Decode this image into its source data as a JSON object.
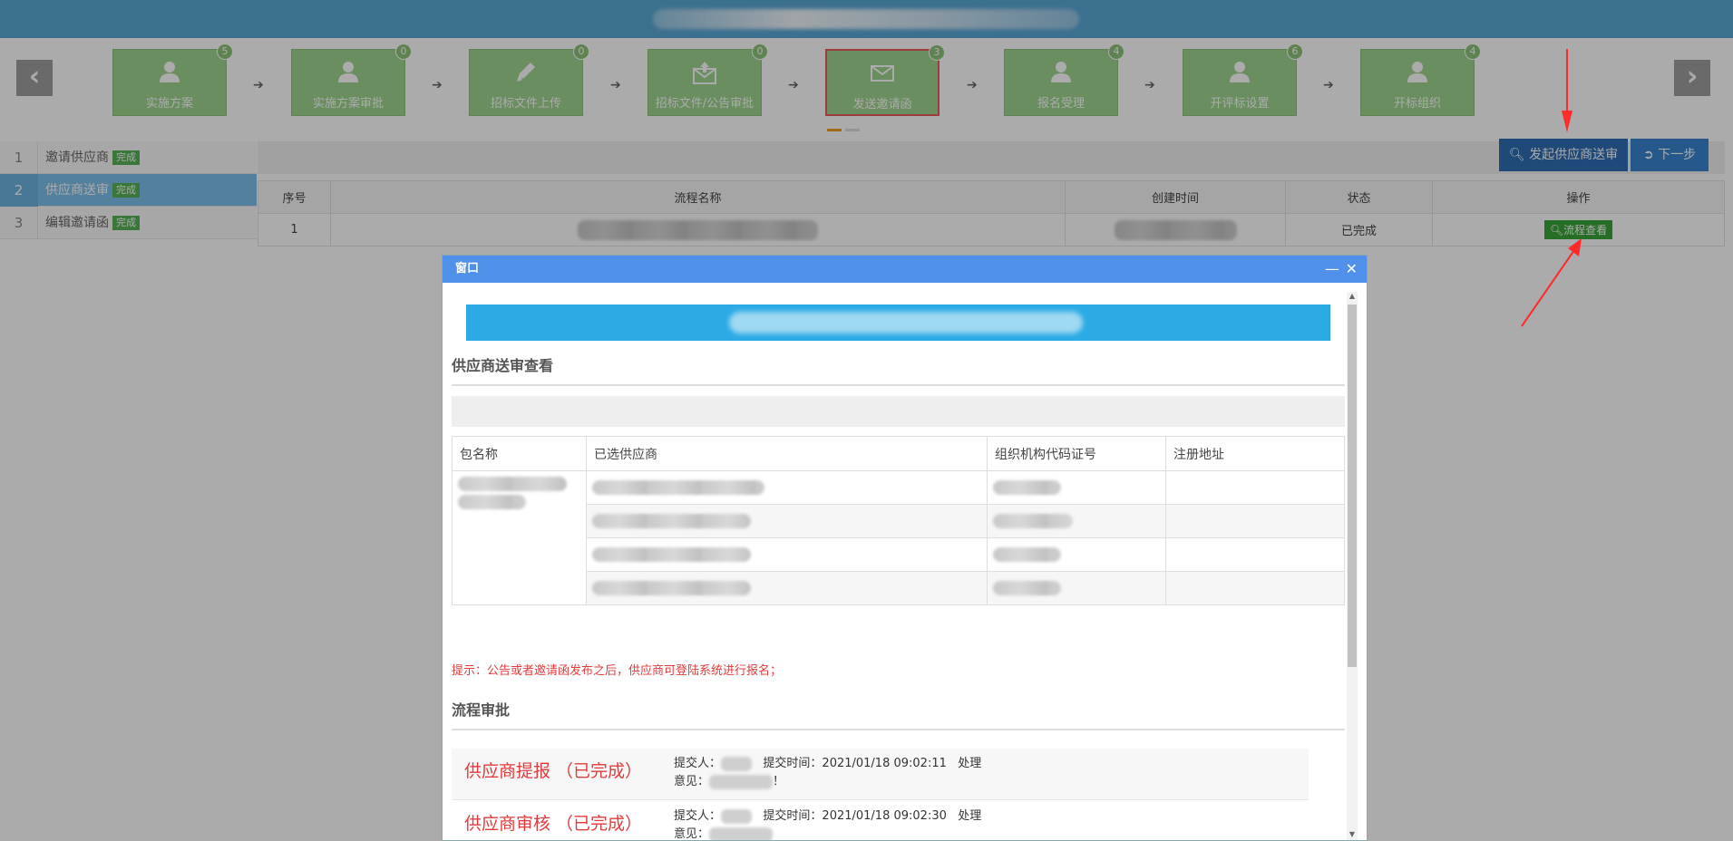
{
  "steps": [
    {
      "label": "实施方案",
      "badge": "5",
      "icon": "user-icon"
    },
    {
      "label": "实施方案审批",
      "badge": "0",
      "icon": "user-icon"
    },
    {
      "label": "招标文件上传",
      "badge": "0",
      "icon": "pencil-icon"
    },
    {
      "label": "招标文件/公告审批",
      "badge": "0",
      "icon": "upload-envelope-icon"
    },
    {
      "label": "发送邀请函",
      "badge": "3",
      "icon": "mail-icon"
    },
    {
      "label": "报名受理",
      "badge": "4",
      "icon": "user-icon"
    },
    {
      "label": "开评标设置",
      "badge": "6",
      "icon": "user-icon"
    },
    {
      "label": "开标组织",
      "badge": "4",
      "icon": "user-icon"
    }
  ],
  "nav": {
    "prev": "‹",
    "next": "›"
  },
  "sidemenu": [
    {
      "num": "1",
      "name": "邀请供应商",
      "status": "完成"
    },
    {
      "num": "2",
      "name": "供应商送审",
      "status": "完成"
    },
    {
      "num": "3",
      "name": "编辑邀请函",
      "status": "完成"
    }
  ],
  "toolbar": {
    "send_label": "发起供应商送审",
    "next_label": "下一步"
  },
  "grid": {
    "headers": [
      "序号",
      "流程名称",
      "创建时间",
      "状态",
      "操作"
    ],
    "rows": [
      {
        "index": "1",
        "status": "已完成",
        "action": "流程查看"
      }
    ]
  },
  "modal": {
    "title": "窗口",
    "minimize": "—",
    "close": "✕",
    "section1": "供应商送审查看",
    "table_headers": [
      "包名称",
      "已选供应商",
      "组织机构代码证号",
      "注册地址"
    ],
    "hint": "提示：公告或者邀请函发布之后，供应商可登陆系统进行报名；",
    "section2": "流程审批",
    "flows": [
      {
        "name": "供应商提报 （已完成）",
        "submitter_label": "提交人：",
        "time_label": "提交时间：2021/01/18 09:02:11",
        "action": "处理",
        "opinion_label": "意见：",
        "opinion_suffix": "！"
      },
      {
        "name": "供应商审核 （已完成）",
        "submitter_label": "提交人：",
        "time_label": "提交时间：2021/01/18 09:02:30",
        "action": "处理",
        "opinion_label": "意见：",
        "opinion_suffix": ""
      }
    ]
  },
  "colors": {
    "accent": "#4f90ea",
    "step_green": "#9fd48f",
    "annotation_red": "#ff2a2a",
    "hint_red": "#e23b3b"
  }
}
